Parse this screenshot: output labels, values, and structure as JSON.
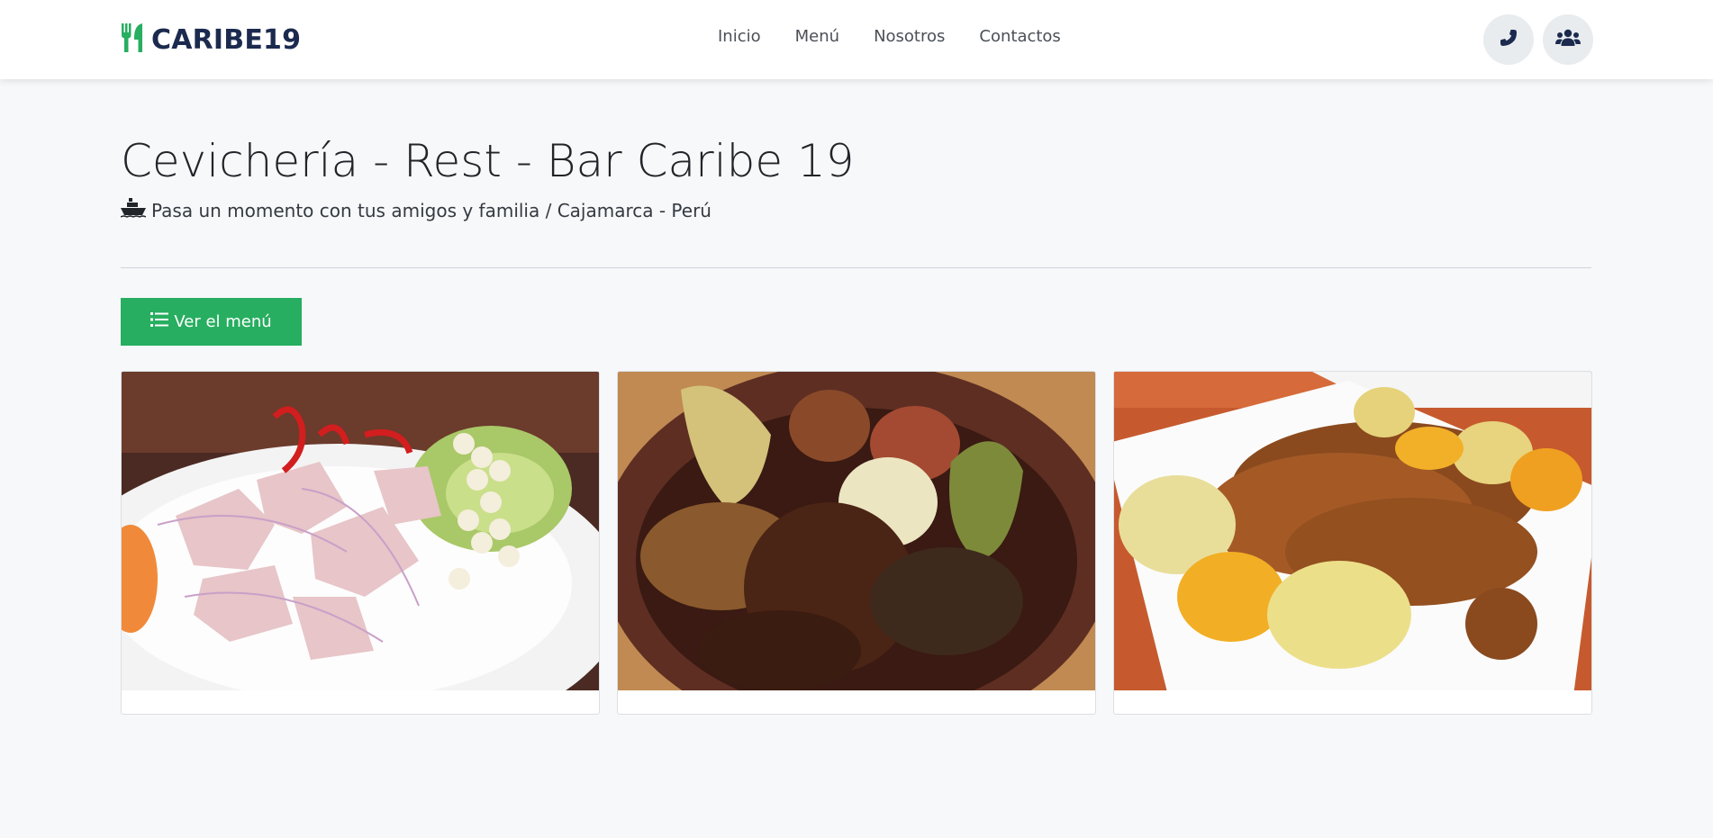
{
  "brand": {
    "name": "CARIBE19",
    "icon": "utensils-icon"
  },
  "nav": {
    "links": [
      {
        "label": "Inicio"
      },
      {
        "label": "Menú"
      },
      {
        "label": "Nosotros"
      },
      {
        "label": "Contactos"
      }
    ],
    "phone_icon": "phone-icon",
    "users_icon": "users-icon"
  },
  "hero": {
    "title": "Cevichería - Rest - Bar Caribe 19",
    "subtitle": "Pasa un momento con tus amigos y familia / Cajamarca - Perú",
    "subtitle_icon": "ship-icon"
  },
  "menu_button": {
    "label": "Ver el menú",
    "icon": "list-icon"
  },
  "gallery": [
    {
      "dish_icon": "ceviche-photo"
    },
    {
      "dish_icon": "pachamanca-photo"
    },
    {
      "dish_icon": "cuy-frito-photo"
    }
  ],
  "colors": {
    "accent": "#27ae60",
    "brand_text": "#1b2a4e",
    "background": "#f7f8fa"
  }
}
